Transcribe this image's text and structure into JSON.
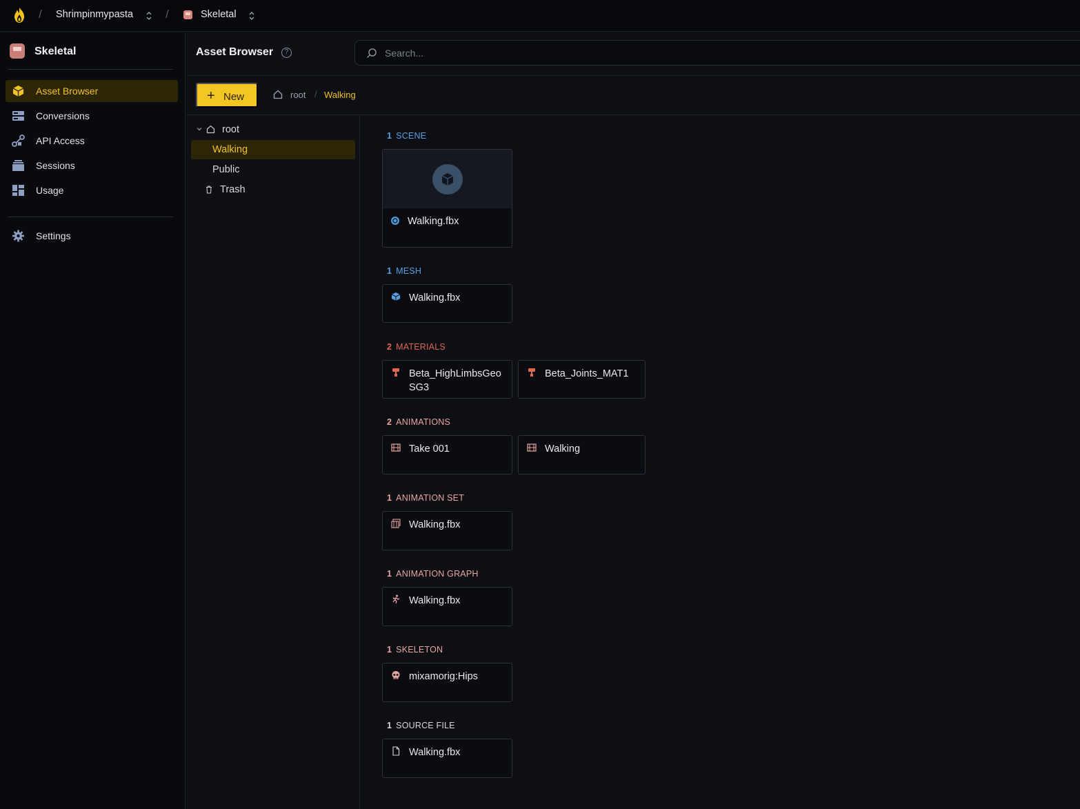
{
  "topbar": {
    "org": "Shrimpinmypasta",
    "project": "Skeletal",
    "separator": "/"
  },
  "sidebar": {
    "project_name": "Skeletal",
    "items": [
      {
        "label": "Asset Browser",
        "icon": "cube-icon",
        "active": true
      },
      {
        "label": "Conversions",
        "icon": "server-stack-icon"
      },
      {
        "label": "API Access",
        "icon": "key-link-icon"
      },
      {
        "label": "Sessions",
        "icon": "layers-icon"
      },
      {
        "label": "Usage",
        "icon": "dashboard-grid-icon"
      }
    ],
    "settings_label": "Settings"
  },
  "header": {
    "title": "Asset Browser",
    "help": "?",
    "search_placeholder": "Search..."
  },
  "toolbar": {
    "new_label": "New",
    "new_plus": "+",
    "breadcrumb_root": "root",
    "breadcrumb_sep": "/",
    "breadcrumb_current": "Walking"
  },
  "tree": {
    "root": "root",
    "children": [
      "Walking",
      "Public"
    ],
    "trash": "Trash"
  },
  "sections": [
    {
      "count": "1",
      "title": "SCENE",
      "color": "#5aa0e0",
      "items": [
        "Walking.fbx"
      ]
    },
    {
      "count": "1",
      "title": "MESH",
      "color": "#5aa0e0",
      "items": [
        "Walking.fbx"
      ]
    },
    {
      "count": "2",
      "title": "MATERIALS",
      "color": "#e0664e",
      "items": [
        "Beta_HighLimbsGeoSG3",
        "Beta_Joints_MAT1"
      ]
    },
    {
      "count": "2",
      "title": "ANIMATIONS",
      "color": "#e8a6a0",
      "items": [
        "Take 001",
        "Walking"
      ]
    },
    {
      "count": "1",
      "title": "ANIMATION SET",
      "color": "#e8a6a0",
      "items": [
        "Walking.fbx"
      ]
    },
    {
      "count": "1",
      "title": "ANIMATION GRAPH",
      "color": "#e8a6a0",
      "items": [
        "Walking.fbx"
      ]
    },
    {
      "count": "1",
      "title": "SKELETON",
      "color": "#e8a6a0",
      "items": [
        "mixamorig:Hips"
      ]
    },
    {
      "count": "1",
      "title": "SOURCE FILE",
      "color": "#d8d9dd",
      "items": [
        "Walking.fbx"
      ]
    }
  ],
  "colors": {
    "accent": "#f4c624",
    "active_bg": "#2c2606",
    "background": "#0d0f15"
  }
}
